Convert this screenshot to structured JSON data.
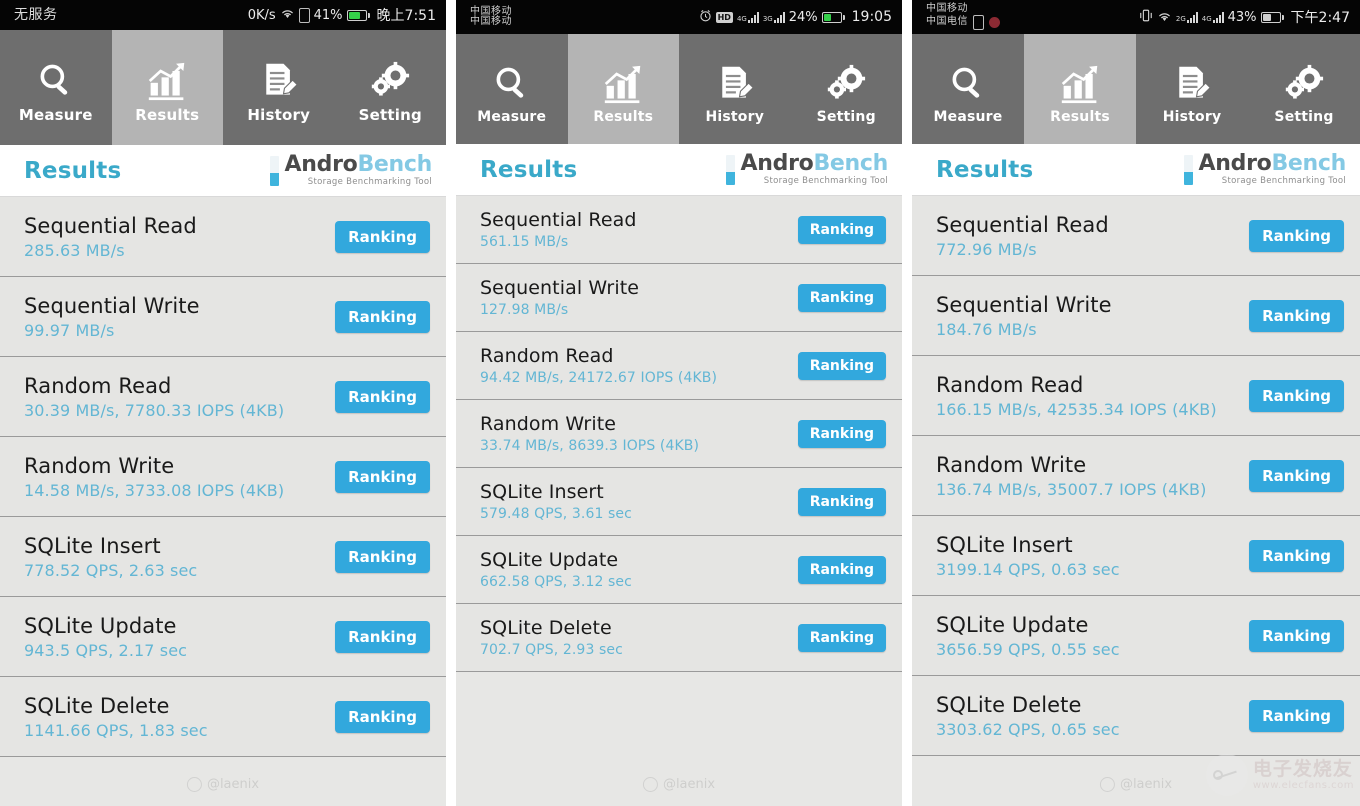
{
  "app": {
    "logo": {
      "part1": "Andro",
      "part2": "Bench",
      "subtitle": "Storage Benchmarking Tool"
    },
    "section_title": "Results",
    "ranking_label": "Ranking",
    "accent_blue": "#32a8dd",
    "value_blue": "#63b6d4",
    "title_blue": "#3aa9c9",
    "tabbar_bg": "#6e6e6e",
    "tab_active_bg": "#b4b4b4",
    "row_bg": "#e5e5e3"
  },
  "tabs": [
    {
      "label": "Measure",
      "icon": "magnifier-icon",
      "active": false
    },
    {
      "label": "Results",
      "icon": "bar-chart-icon",
      "active": true
    },
    {
      "label": "History",
      "icon": "document-pencil-icon",
      "active": false
    },
    {
      "label": "Setting",
      "icon": "gears-icon",
      "active": false
    }
  ],
  "watermarks": {
    "weibo": "@laenix",
    "elecfans_cn": "电子发烧友",
    "elecfans_url": "www.elecfans.com"
  },
  "panels": [
    {
      "id": "panel-1",
      "status": {
        "carrier": "无服务",
        "carrier2": "",
        "net_speed": "0K/s",
        "battery_pct": "41%",
        "time": "晚上7:51",
        "icons": [
          "wifi-icon",
          "sim-icon",
          "battery-icon"
        ]
      },
      "results": [
        {
          "name": "Sequential Read",
          "value": "285.63 MB/s"
        },
        {
          "name": "Sequential Write",
          "value": "99.97 MB/s"
        },
        {
          "name": "Random Read",
          "value": "30.39 MB/s, 7780.33 IOPS (4KB)"
        },
        {
          "name": "Random Write",
          "value": "14.58 MB/s, 3733.08 IOPS (4KB)"
        },
        {
          "name": "SQLite Insert",
          "value": "778.52 QPS, 2.63 sec"
        },
        {
          "name": "SQLite Update",
          "value": "943.5 QPS, 2.17 sec"
        },
        {
          "name": "SQLite Delete",
          "value": "1141.66 QPS, 1.83 sec"
        }
      ]
    },
    {
      "id": "panel-2",
      "status": {
        "carrier": "中国移动",
        "carrier2": "中国移动",
        "net_speed": "",
        "battery_pct": "24%",
        "time": "19:05",
        "icons": [
          "alarm-icon",
          "hd-icon",
          "signal-4g-icon",
          "signal-3g-icon",
          "battery-icon"
        ]
      },
      "results": [
        {
          "name": "Sequential Read",
          "value": "561.15 MB/s"
        },
        {
          "name": "Sequential Write",
          "value": "127.98 MB/s"
        },
        {
          "name": "Random Read",
          "value": "94.42 MB/s, 24172.67 IOPS (4KB)"
        },
        {
          "name": "Random Write",
          "value": "33.74 MB/s, 8639.3 IOPS (4KB)"
        },
        {
          "name": "SQLite Insert",
          "value": "579.48 QPS, 3.61 sec"
        },
        {
          "name": "SQLite Update",
          "value": "662.58 QPS, 3.12 sec"
        },
        {
          "name": "SQLite Delete",
          "value": "702.7 QPS, 2.93 sec"
        }
      ]
    },
    {
      "id": "panel-3",
      "status": {
        "carrier": "中国移动",
        "carrier2": "中国电信",
        "net_speed": "",
        "battery_pct": "43%",
        "time": "下午2:47",
        "icons": [
          "sim-icon",
          "dnd-icon",
          "vibrate-icon",
          "wifi-icon",
          "signal-2g-icon",
          "signal-4g-icon",
          "battery-icon"
        ]
      },
      "results": [
        {
          "name": "Sequential Read",
          "value": "772.96 MB/s"
        },
        {
          "name": "Sequential Write",
          "value": "184.76 MB/s"
        },
        {
          "name": "Random Read",
          "value": "166.15 MB/s, 42535.34 IOPS (4KB)"
        },
        {
          "name": "Random Write",
          "value": "136.74 MB/s, 35007.7 IOPS (4KB)"
        },
        {
          "name": "SQLite Insert",
          "value": "3199.14 QPS, 0.63 sec"
        },
        {
          "name": "SQLite Update",
          "value": "3656.59 QPS, 0.55 sec"
        },
        {
          "name": "SQLite Delete",
          "value": "3303.62 QPS, 0.65 sec"
        }
      ]
    }
  ]
}
